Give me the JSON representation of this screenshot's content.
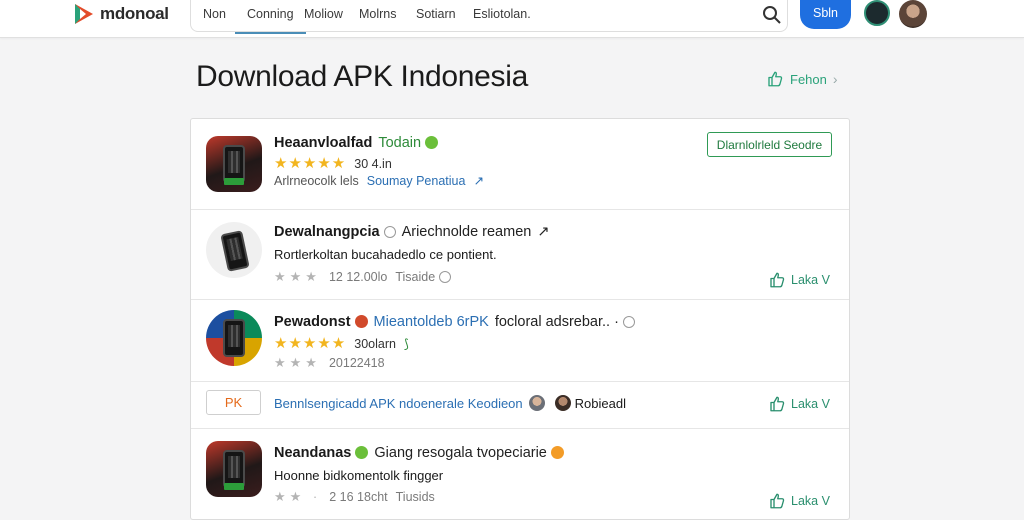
{
  "header": {
    "logo_text": "mdonoal",
    "nav_tabs": [
      {
        "label": "Non"
      },
      {
        "label": "Conning"
      },
      {
        "label": "Moliow"
      },
      {
        "label": "Molrns"
      },
      {
        "label": "Sotiarn"
      },
      {
        "label": "Esliotolan."
      }
    ],
    "active_tab_index": 1,
    "signin_label": "Sbln"
  },
  "page": {
    "title": "Download APK Indonesia",
    "follow_label": "Fehon",
    "chevron": "›"
  },
  "rows": [
    {
      "title": "Heaanvloalfad",
      "subtitle": "Todain",
      "stars": "★★★★★",
      "rating": "30 4.in",
      "meta": "Arlrneocolk lels",
      "meta_link": "Soumay Penatiua",
      "meta_link_icon": "↗",
      "button_label": "Dlarnlolrleld Seodre"
    },
    {
      "title": "Dewalnangpcia",
      "subtitle": "Ariechnolde reamen",
      "subtitle_icon": "↗",
      "desc": "Rortlerkoltan bucahadedlo ce pontient.",
      "stars": "★★★",
      "rating": "12 12.00lo",
      "meta_extra": "Tisaide",
      "like_label": "Laka V"
    },
    {
      "title": "Pewadonst",
      "subtitle": "Mieantoldeb 6rPK",
      "subtitle2": "focloral adsrebar.. ·",
      "stars": "★★★★★",
      "rating": "30olarn",
      "rating_icon": "⟆",
      "meta": "20122418"
    },
    {
      "tag": "PK",
      "text1": "Bennlsengicadd APK ndoenerale Keodieon",
      "text2": "Robieadl",
      "like_label": "Laka V"
    },
    {
      "title": "Neandanas",
      "subtitle": "Giang resogala tvopeciarie",
      "desc": "Ноonne bidkomentolk fingger",
      "stars": "★★ ·",
      "rating": "2 16 18cht",
      "meta_extra": "Tiusids",
      "like_label": "Laka V"
    }
  ],
  "colors": {
    "accent_blue": "#1f6fe0",
    "accent_green": "#2f9a55",
    "star_gold": "#f2b51f",
    "link_blue": "#2b6fb3"
  }
}
